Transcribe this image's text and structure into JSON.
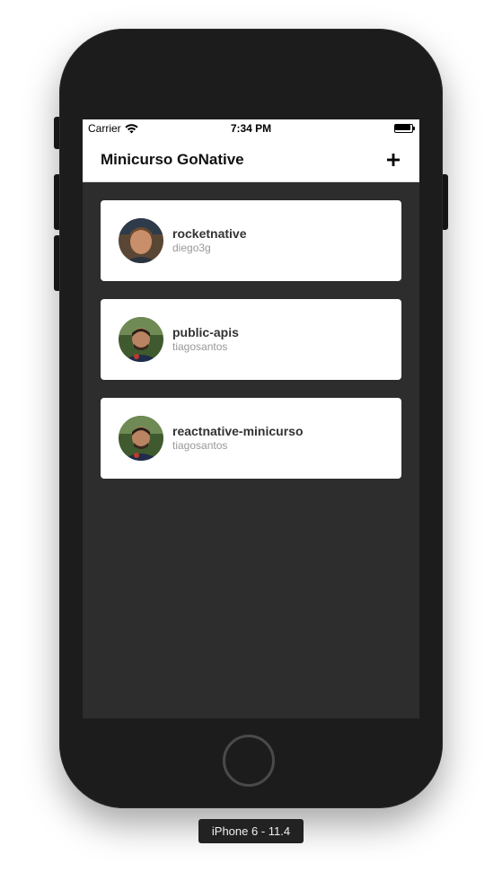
{
  "status_bar": {
    "carrier": "Carrier",
    "time": "7:34 PM",
    "icons": [
      "wifi-icon",
      "battery-icon"
    ]
  },
  "nav": {
    "title": "Minicurso GoNative",
    "add_icon": "plus-icon"
  },
  "repos": [
    {
      "name": "rocketnative",
      "owner": "diego3g"
    },
    {
      "name": "public-apis",
      "owner": "tiagosantos"
    },
    {
      "name": "reactnative-minicurso",
      "owner": "tiagosantos"
    }
  ],
  "device_label": "iPhone 6 - 11.4",
  "colors": {
    "background": "#2d2d2d",
    "card": "#ffffff",
    "title": "#111111",
    "repo_name": "#333333",
    "repo_owner": "#999999",
    "device_frame": "#1c1c1c"
  }
}
